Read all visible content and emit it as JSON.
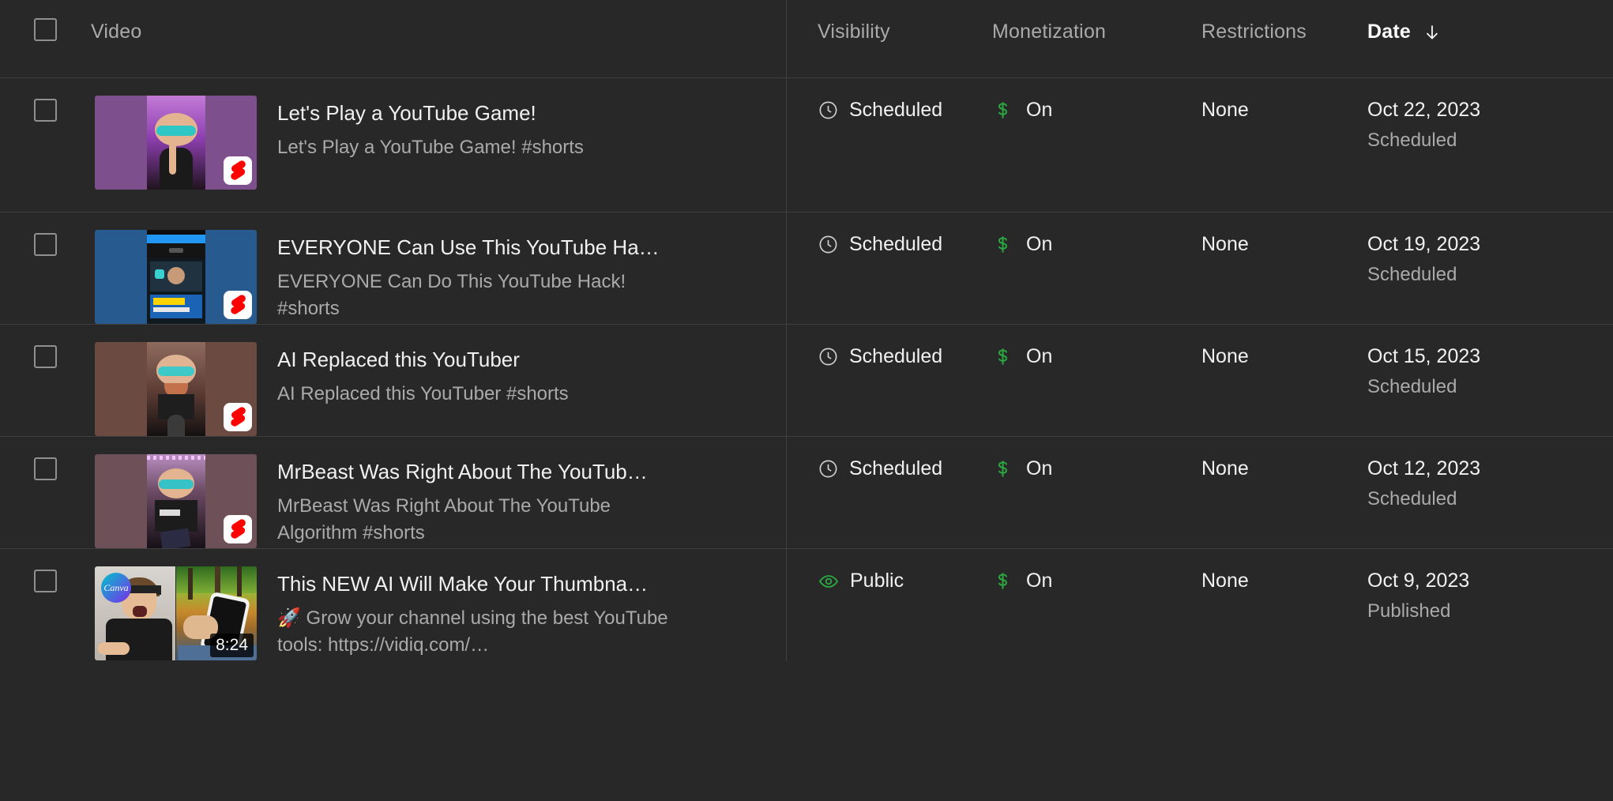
{
  "header": {
    "video_label": "Video",
    "visibility_label": "Visibility",
    "monetization_label": "Monetization",
    "restrictions_label": "Restrictions",
    "date_label": "Date",
    "sort_icon": "arrow-down-icon",
    "sort_active_column": "Date"
  },
  "colors": {
    "page_background": "#282828",
    "row_divider": "#3f3f3f",
    "primary_text": "#f1f1f1",
    "secondary_text": "#aaaaaa",
    "monetization_on": "#2ba640",
    "public_visibility": "#2ba640",
    "shorts_logo_red": "#ff0000"
  },
  "rows": [
    {
      "checkbox_checked": false,
      "title": "Let's Play a YouTube Game!",
      "description": "Let's Play a YouTube Game! #shorts",
      "thumbnail_type": "short",
      "thumbnail_badge": "shorts-icon",
      "thumbnail_bg": "#7d4f8d",
      "visibility": "Scheduled",
      "visibility_icon": "clock-icon",
      "monetization": "On",
      "monetization_icon": "dollar-sign-icon",
      "restrictions": "None",
      "date": "Oct 22, 2023",
      "date_status": "Scheduled"
    },
    {
      "checkbox_checked": false,
      "title": "EVERYONE Can Use This YouTube Ha…",
      "description": "EVERYONE Can Do This YouTube Hack! #shorts",
      "thumbnail_type": "short",
      "thumbnail_badge": "shorts-icon",
      "thumbnail_bg": "#275a8e",
      "visibility": "Scheduled",
      "visibility_icon": "clock-icon",
      "monetization": "On",
      "monetization_icon": "dollar-sign-icon",
      "restrictions": "None",
      "date": "Oct 19, 2023",
      "date_status": "Scheduled"
    },
    {
      "checkbox_checked": false,
      "title": "AI Replaced this YouTuber",
      "description": "AI Replaced this YouTuber #shorts",
      "thumbnail_type": "short",
      "thumbnail_badge": "shorts-icon",
      "thumbnail_bg": "#6b4a42",
      "visibility": "Scheduled",
      "visibility_icon": "clock-icon",
      "monetization": "On",
      "monetization_icon": "dollar-sign-icon",
      "restrictions": "None",
      "date": "Oct 15, 2023",
      "date_status": "Scheduled"
    },
    {
      "checkbox_checked": false,
      "title": "MrBeast Was Right About The YouTub…",
      "description": "MrBeast Was Right About The YouTube Algorithm #shorts",
      "thumbnail_type": "short",
      "thumbnail_badge": "shorts-icon",
      "thumbnail_bg": "#6e5058",
      "visibility": "Scheduled",
      "visibility_icon": "clock-icon",
      "monetization": "On",
      "monetization_icon": "dollar-sign-icon",
      "restrictions": "None",
      "date": "Oct 12, 2023",
      "date_status": "Scheduled"
    },
    {
      "checkbox_checked": false,
      "title": "This NEW AI Will Make Your Thumbna…",
      "description": "🚀 Grow your channel using the best YouTube tools: https://vidiq.com/…",
      "thumbnail_type": "video",
      "thumbnail_badge": "duration-badge",
      "duration": "8:24",
      "thumbnail_logo": "Canva",
      "visibility": "Public",
      "visibility_icon": "eye-icon",
      "monetization": "On",
      "monetization_icon": "dollar-sign-icon",
      "restrictions": "None",
      "date": "Oct 9, 2023",
      "date_status": "Published"
    }
  ]
}
